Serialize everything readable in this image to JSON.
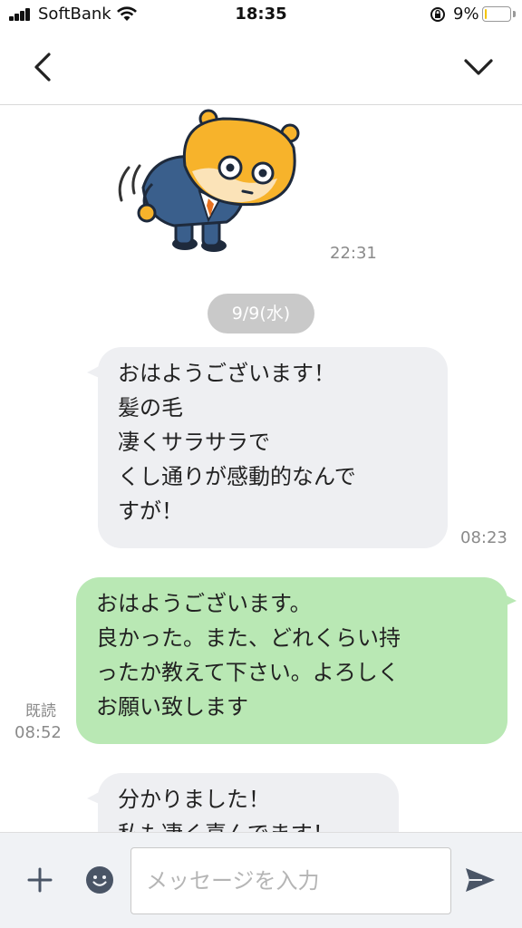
{
  "status_bar": {
    "carrier": "SoftBank",
    "time": "18:35",
    "battery_percent": "9%",
    "battery_level": 0.09,
    "battery_color": "#f5c400",
    "icons": [
      "signal-icon",
      "wifi-icon",
      "orientation-lock-icon",
      "battery-icon"
    ]
  },
  "header": {
    "back_icon": "chevron-left-icon",
    "menu_icon": "chevron-down-icon"
  },
  "messages": {
    "sticker": {
      "description_icon": "bowing-hamster-sticker",
      "time": "22:31"
    },
    "date_separator": "9/9(水)",
    "incoming_1": {
      "text": "おはようございます！\n髪の毛\n凄くサラサラで\nくし通りが感動的なんで\nすが！",
      "time": "08:23"
    },
    "outgoing_1": {
      "text": "おはようございます。\n良かった。また、どれくらい持\nったか教えて下さい。よろしく\nお願い致します",
      "read_label": "既読",
      "time": "08:52"
    },
    "incoming_2": {
      "text": "分かりました！\n私も凄く喜んでます！"
    }
  },
  "input_bar": {
    "placeholder": "メッセージを入力",
    "plus_icon": "plus-icon",
    "emoji_icon": "emoji-icon",
    "send_icon": "send-icon"
  },
  "colors": {
    "incoming_bubble": "#eeeff2",
    "outgoing_bubble": "#b9e8b4",
    "date_pill": "#c9c9c9"
  }
}
